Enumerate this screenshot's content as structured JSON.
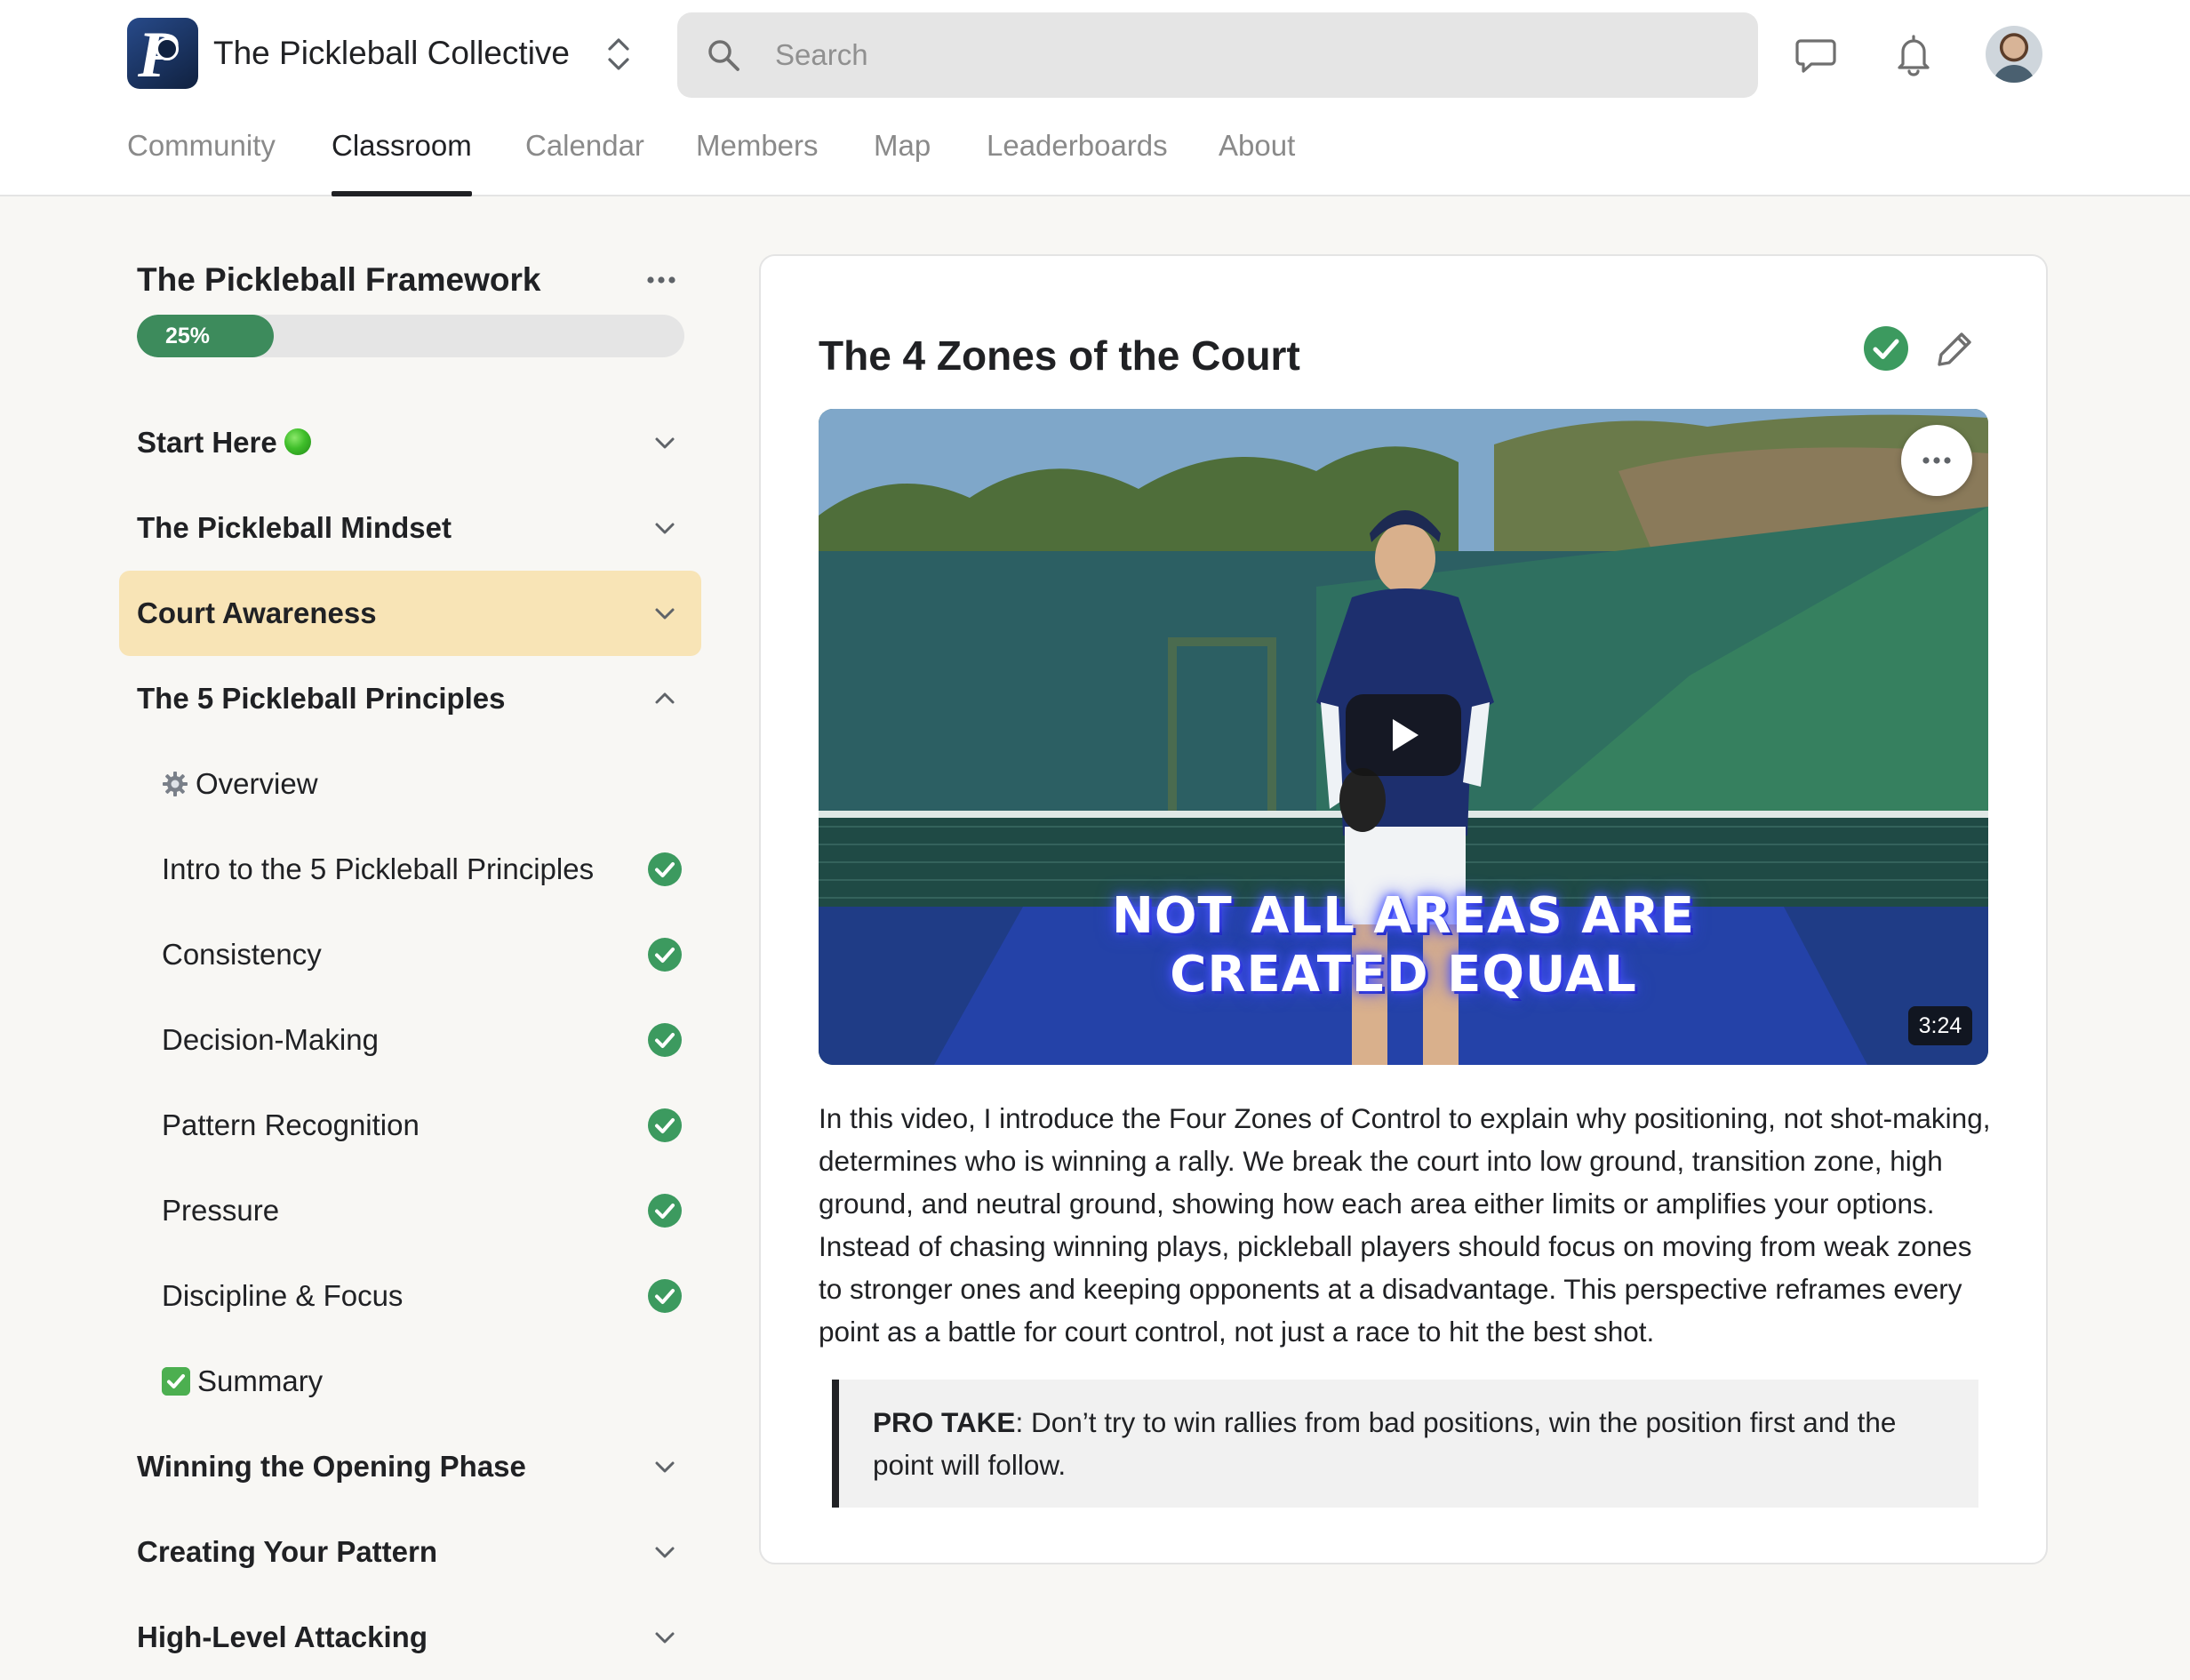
{
  "header": {
    "group_name": "The Pickleball Collective",
    "search_placeholder": "Search"
  },
  "nav": {
    "tabs": [
      "Community",
      "Classroom",
      "Calendar",
      "Members",
      "Map",
      "Leaderboards",
      "About"
    ],
    "active": "Classroom"
  },
  "course": {
    "title": "The Pickleball Framework",
    "progress_label": "25%",
    "progress": 0.25,
    "modules_top": [
      {
        "label": "Start Here",
        "emoji": "green-circle-icon",
        "expanded": false
      },
      {
        "label": "The Pickleball Mindset",
        "expanded": false
      },
      {
        "label": "Court Awareness",
        "expanded": false,
        "active": true
      },
      {
        "label": "The 5 Pickleball Principles",
        "expanded": true
      }
    ],
    "lessons": [
      {
        "label": "Overview",
        "emoji": "gear-icon",
        "completed": false
      },
      {
        "label": "Intro to the 5 Pickleball Principles",
        "completed": true
      },
      {
        "label": "Consistency",
        "completed": true
      },
      {
        "label": "Decision-Making",
        "completed": true
      },
      {
        "label": "Pattern Recognition",
        "completed": true
      },
      {
        "label": "Pressure",
        "completed": true
      },
      {
        "label": "Discipline & Focus",
        "completed": true
      },
      {
        "label": "Summary",
        "emoji": "check-box-icon",
        "completed": false
      }
    ],
    "modules_bottom": [
      {
        "label": "Winning the Opening Phase",
        "expanded": false
      },
      {
        "label": "Creating Your Pattern",
        "expanded": false
      },
      {
        "label": "High-Level Attacking",
        "expanded": false
      }
    ]
  },
  "lesson": {
    "title": "The 4 Zones of the Court",
    "completed": true,
    "video": {
      "overlay_line1": "NOT ALL AREAS ARE",
      "overlay_line2": "CREATED EQUAL",
      "duration": "3:24"
    },
    "description": "In this video, I introduce the Four Zones of Control to explain why positioning, not shot-making, determines who is winning a rally. We break the court into low ground, transition zone, high ground, and neutral ground, showing how each area either limits or amplifies your options. Instead of chasing winning plays, pickleball players should focus on moving from weak zones to stronger ones and keeping opponents at a disadvantage. This perspective reframes every point as a battle for court control, not just a race to hit the best shot.",
    "pro_take_label": "PRO TAKE",
    "pro_take_text": ": Don’t try to win rallies from bad positions, win the position first and the point will follow."
  },
  "colors": {
    "accent_green": "#3d8b5c",
    "check_green": "#3c9a5f",
    "active_module_bg": "#f8e4b6",
    "text": "#202124",
    "muted": "#8a8a8a"
  }
}
